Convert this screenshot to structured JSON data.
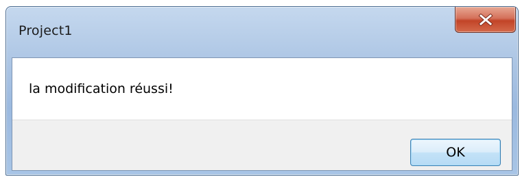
{
  "window": {
    "title": "Project1"
  },
  "dialog": {
    "message": "la modification réussi!",
    "ok_label": "OK"
  },
  "icons": {
    "close": "close-icon"
  },
  "colors": {
    "close_button": "#c8482b",
    "titlebar": "#a9c3e3",
    "ok_border": "#3c7fb1"
  }
}
